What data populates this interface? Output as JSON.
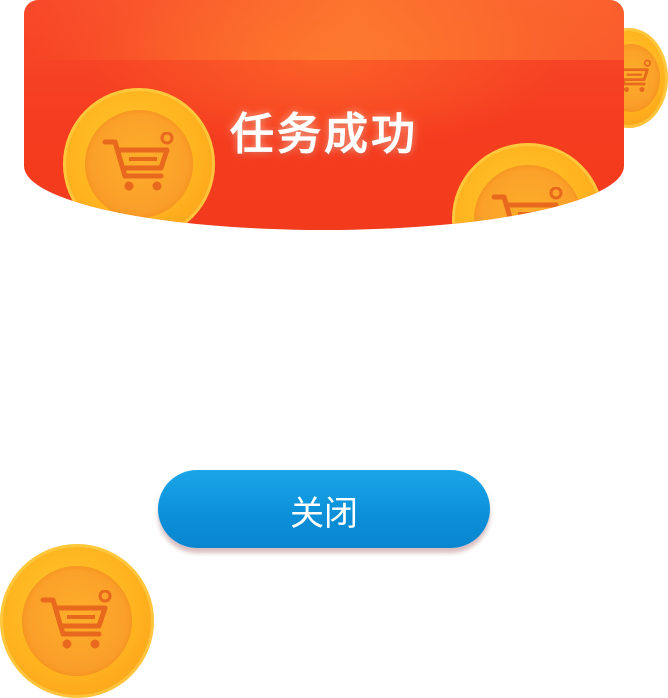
{
  "dialog": {
    "title": "任务成功",
    "close_label": "关闭"
  },
  "icons": {
    "coin": "shopping-cart-coin-icon"
  },
  "colors": {
    "header_red": "#f53c20",
    "coin_gold": "#ffb21e",
    "cart_orange": "#e86b1f",
    "button_blue": "#0b8fd8"
  }
}
